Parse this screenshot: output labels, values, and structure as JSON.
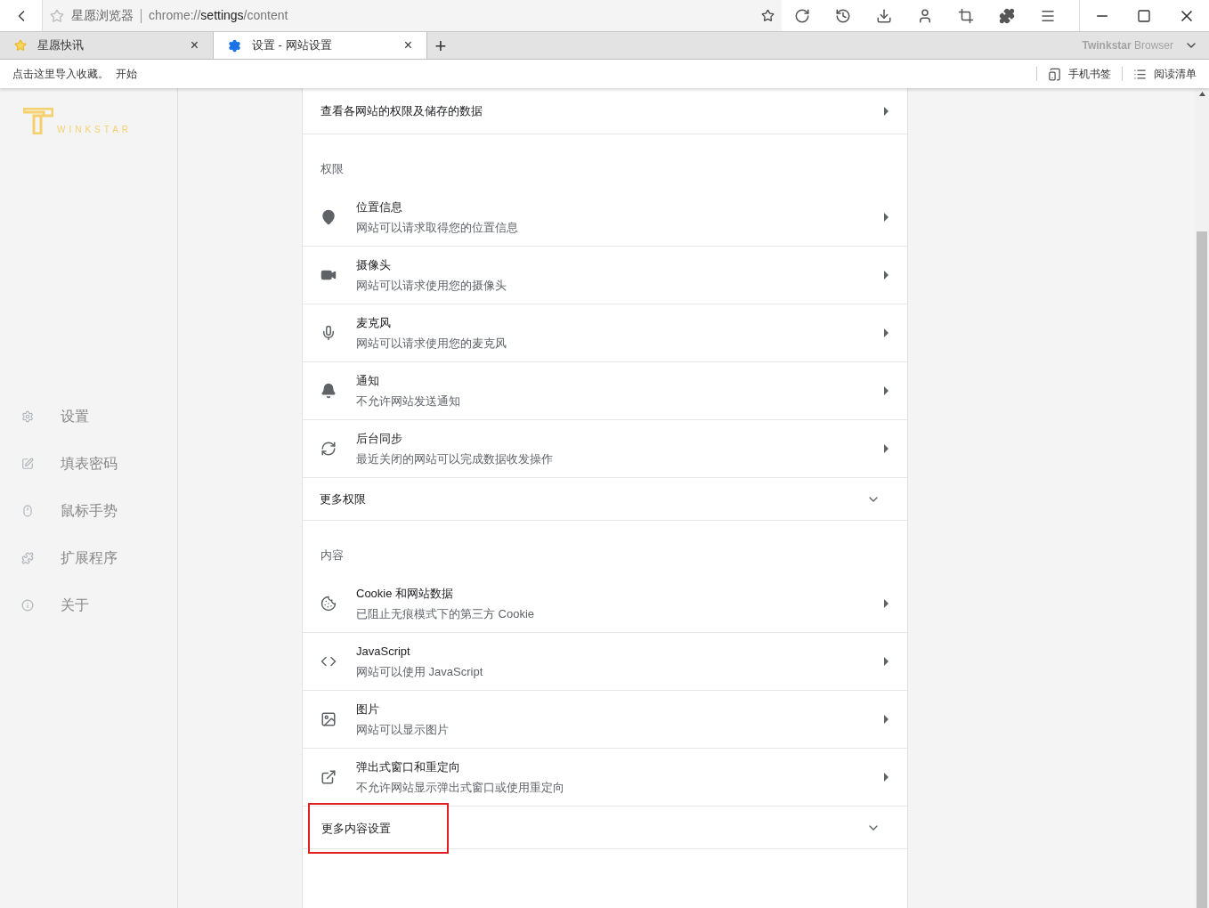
{
  "address_bar": {
    "site_name": "星愿浏览器",
    "url_prefix": "chrome://",
    "url_host": "settings",
    "url_path": "/content"
  },
  "tabs": [
    {
      "label": "星愿快讯",
      "selected": false,
      "close": "×"
    },
    {
      "label": "设置 - 网站设置",
      "selected": true,
      "close": "×"
    }
  ],
  "new_tab": "+",
  "brand": {
    "name": "Twinkstar",
    "suffix": "Browser"
  },
  "bookmarks_bar": {
    "hint": "点击这里导入收藏。",
    "start": "开始",
    "mobile_bookmarks": "手机书签",
    "reading_list": "阅读清单"
  },
  "sidebar": {
    "logo_text": "WINKSTAR",
    "items": [
      {
        "label": "设置",
        "selected": false
      },
      {
        "label": "填表密码",
        "selected": false
      },
      {
        "label": "鼠标手势",
        "selected": false
      },
      {
        "label": "扩展程序",
        "selected": false
      },
      {
        "label": "关于",
        "selected": false
      }
    ]
  },
  "card": {
    "rows": [
      {
        "kind": "link",
        "title": "查看各网站的权限及储存的数据"
      },
      {
        "kind": "header",
        "title": "权限"
      },
      {
        "kind": "item",
        "title": "位置信息",
        "subtitle": "网站可以请求取得您的位置信息"
      },
      {
        "kind": "item",
        "title": "摄像头",
        "subtitle": "网站可以请求使用您的摄像头"
      },
      {
        "kind": "item",
        "title": "麦克风",
        "subtitle": "网站可以请求使用您的麦克风"
      },
      {
        "kind": "item",
        "title": "通知",
        "subtitle": "不允许网站发送通知"
      },
      {
        "kind": "item",
        "title": "后台同步",
        "subtitle": "最近关闭的网站可以完成数据收发操作"
      },
      {
        "kind": "expand",
        "title": "更多权限",
        "expanded": false,
        "highlighted": false
      },
      {
        "kind": "header",
        "title": "内容"
      },
      {
        "kind": "item",
        "title": "Cookie 和网站数据",
        "subtitle": "已阻止无痕模式下的第三方 Cookie"
      },
      {
        "kind": "item",
        "title": "JavaScript",
        "subtitle": "网站可以使用 JavaScript"
      },
      {
        "kind": "item",
        "title": "图片",
        "subtitle": "网站可以显示图片"
      },
      {
        "kind": "item",
        "title": "弹出式窗口和重定向",
        "subtitle": "不允许网站显示弹出式窗口或使用重定向"
      },
      {
        "kind": "expand",
        "title": "更多内容设置",
        "expanded": false,
        "highlighted": true
      }
    ]
  }
}
